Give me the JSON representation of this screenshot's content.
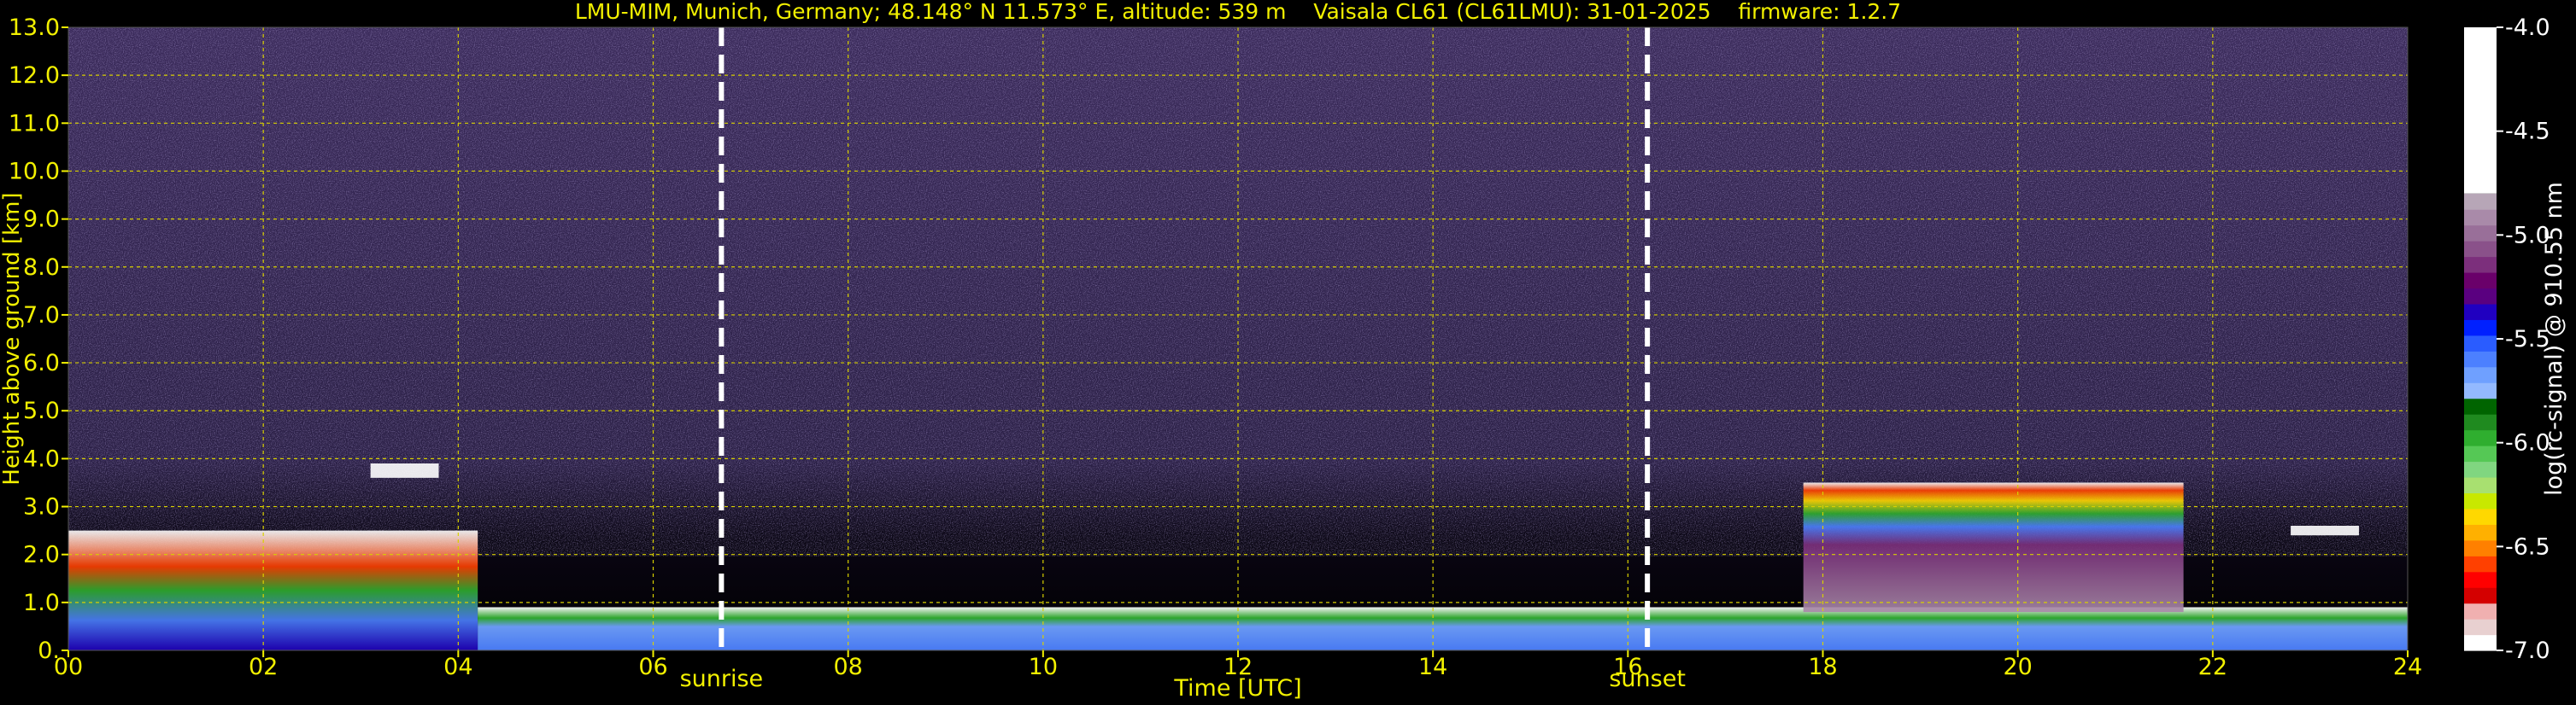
{
  "chart_data": {
    "type": "heatmap",
    "title": "LMU-MIM, Munich, Germany; 48.148° N 11.573° E, altitude: 539 m    Vaisala CL61 (CL61LMU): 31-01-2025    firmware: 1.2.7",
    "xlabel": "Time [UTC]",
    "ylabel": "Height above ground [km]",
    "xlim": [
      0,
      24
    ],
    "ylim": [
      0,
      13
    ],
    "x_ticks": [
      "00",
      "02",
      "04",
      "06",
      "08",
      "10",
      "12",
      "14",
      "16",
      "18",
      "20",
      "22",
      "24"
    ],
    "y_ticks": [
      "0.",
      "1.0",
      "2.0",
      "3.0",
      "4.0",
      "5.0",
      "6.0",
      "7.0",
      "8.0",
      "9.0",
      "10.0",
      "11.0",
      "12.0",
      "13.0"
    ],
    "grid": true,
    "markers": [
      {
        "label": "sunrise",
        "time_utc": 6.7
      },
      {
        "label": "sunset",
        "time_utc": 16.2
      }
    ],
    "colorbar": {
      "label": "log(rc-signal) @ 910.55 nm",
      "range": [
        -7.0,
        -4.0
      ],
      "ticks": [
        "-4.0",
        "-4.5",
        "-5.0",
        "-5.5",
        "-6.0",
        "-6.5",
        "-7.0"
      ],
      "colors": [
        "#b7a6b7",
        "#a98aa9",
        "#996f99",
        "#8a518a",
        "#7c2f7c",
        "#6a006a",
        "#5a0080",
        "#2000c0",
        "#0020ff",
        "#2a5cff",
        "#4c80ff",
        "#6fa0ff",
        "#93b9ff",
        "#006400",
        "#1f8a1f",
        "#2fae2f",
        "#55c855",
        "#80d680",
        "#a8e070",
        "#c8e800",
        "#ffd800",
        "#ffb000",
        "#ff8000",
        "#ff4000",
        "#ff0000",
        "#d40000",
        "#f0b0b0",
        "#e8d0d0",
        "#ffffff"
      ]
    },
    "features": [
      {
        "description": "low cloud / aerosol layer",
        "x_range": [
          0,
          4.2
        ],
        "height_km_range": [
          0,
          2.5
        ]
      },
      {
        "description": "boundary layer",
        "x_range": [
          4.2,
          24
        ],
        "height_km_range": [
          0,
          0.9
        ]
      },
      {
        "description": "cloud layer",
        "x_range": [
          17.8,
          21.7
        ],
        "height_km_range": [
          0.8,
          3.5
        ]
      },
      {
        "description": "thin cloud",
        "x_range": [
          3.1,
          3.8
        ],
        "height_km_range": [
          3.6,
          3.9
        ]
      },
      {
        "description": "thin cloud",
        "x_range": [
          22.8,
          23.5
        ],
        "height_km_range": [
          2.4,
          2.6
        ]
      }
    ]
  }
}
